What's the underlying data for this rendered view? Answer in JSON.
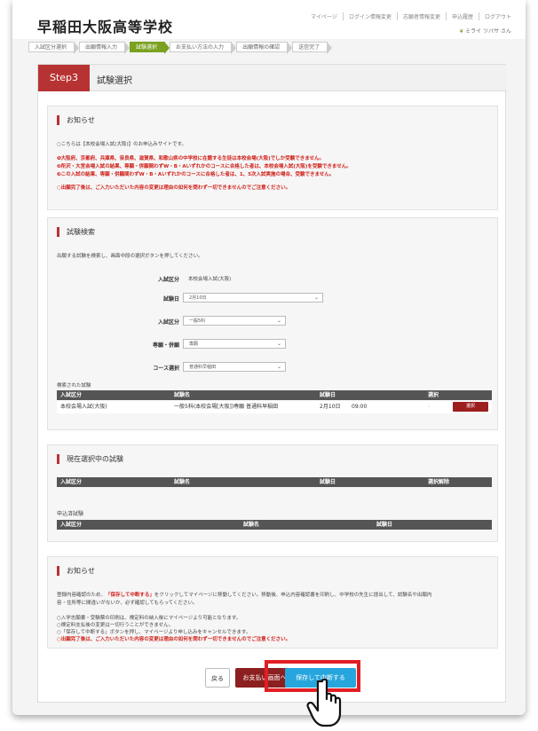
{
  "header": {
    "logo": "早稲田大阪高等学校",
    "nav": [
      "マイページ",
      "ログイン情報変更",
      "志願者情報変更",
      "申込履歴",
      "ログアウト"
    ],
    "user_name": "ミライ ツバサ さん"
  },
  "steps": [
    "入試区分選択",
    "出願情報入力",
    "試験選択",
    "お支払い方法の入力",
    "出願情報の確認",
    "送信完了"
  ],
  "page": {
    "step_badge": "Step3",
    "title": "試験選択"
  },
  "notice1": {
    "heading": "お知らせ",
    "line1": "○こちらは【本校会場入試(大阪)】のお申込みサイトです。",
    "line2": "❶大阪府、京都府、兵庫県、奈良県、滋賀県、和歌山県の中学校に在籍する生徒は本校会場(大阪)でしか受験できません。",
    "line3": "❷所沢・大宮会場入試の結果、専願・併願関わずW・B・Aいずれかのコースに合格した者は、本校会場入試(大阪)を受験できません。",
    "line4": "❸この入試の結果、専願・併願関わずW・B・Aいずれかのコースに合格した者は、1、5次入試実施の場合、受験できません。",
    "line5": "○出願完了後は、ご入力いただいた内容の変更は理由の如何を問わず一切できませんのでご注意ください。"
  },
  "search": {
    "heading": "試験検索",
    "intro": "出願する試験を検索し、画面中段の選択ボタンを押してください。",
    "fields": [
      {
        "label": "入試区分",
        "value": "本校会場入試(大阪)"
      },
      {
        "label": "試験日",
        "value": "2月10日"
      },
      {
        "label": "入試区分",
        "value": "一般5科"
      },
      {
        "label": "専願・併願",
        "value": "専願"
      },
      {
        "label": "コース選択",
        "value": "普通科早稲田"
      }
    ],
    "results_label": "検索された試験",
    "columns": [
      "入試区分",
      "試験名",
      "試験日",
      "選択"
    ],
    "row": {
      "kubun": "本校会場入試(大阪)",
      "name": "一般5科(本校会場[大阪])専願 普通科早稲田",
      "date": "2月10日",
      "time": "09:00",
      "button": "選択"
    }
  },
  "current": {
    "heading": "現在選択中の試験",
    "columns": [
      "入試区分",
      "試験名",
      "試験日",
      "選択解除"
    ],
    "applied_label": "申込済試験",
    "applied_columns": [
      "入試区分",
      "試験名",
      "試験日"
    ]
  },
  "notice2": {
    "heading": "お知らせ",
    "p1a": "登録内容確認のため、",
    "p1b": "「保存して中断する」",
    "p1c": "をクリックしてマイページに移動してください。移動後、申込内容確認書を印刷し、中学校の先生に提出して、試験名や出願内",
    "p1d": "容・住所等に間違いがないか、必ず確認してもらってください。",
    "l1": "○入学志願書・受験票の印刷は、検定料の納入後にマイページより可能となります。",
    "l2": "○検定料支払後の変更は一切行うことができません。",
    "l3": "○「保存して中断する」ボタンを押し、マイページより申し込みをキャンセルできます。",
    "l4": "○出願完了後は、ご入力いただいた内容の変更は理由の如何を問わず一切できませんのでご注意ください。"
  },
  "buttons": {
    "back": "戻る",
    "payment": "お支払い画面へ",
    "save": "保存して中断する"
  },
  "colors": {
    "accent_red": "#b73333",
    "step_green": "#7aa11f",
    "save_blue": "#27a6dd",
    "highlight": "#e21e25"
  }
}
